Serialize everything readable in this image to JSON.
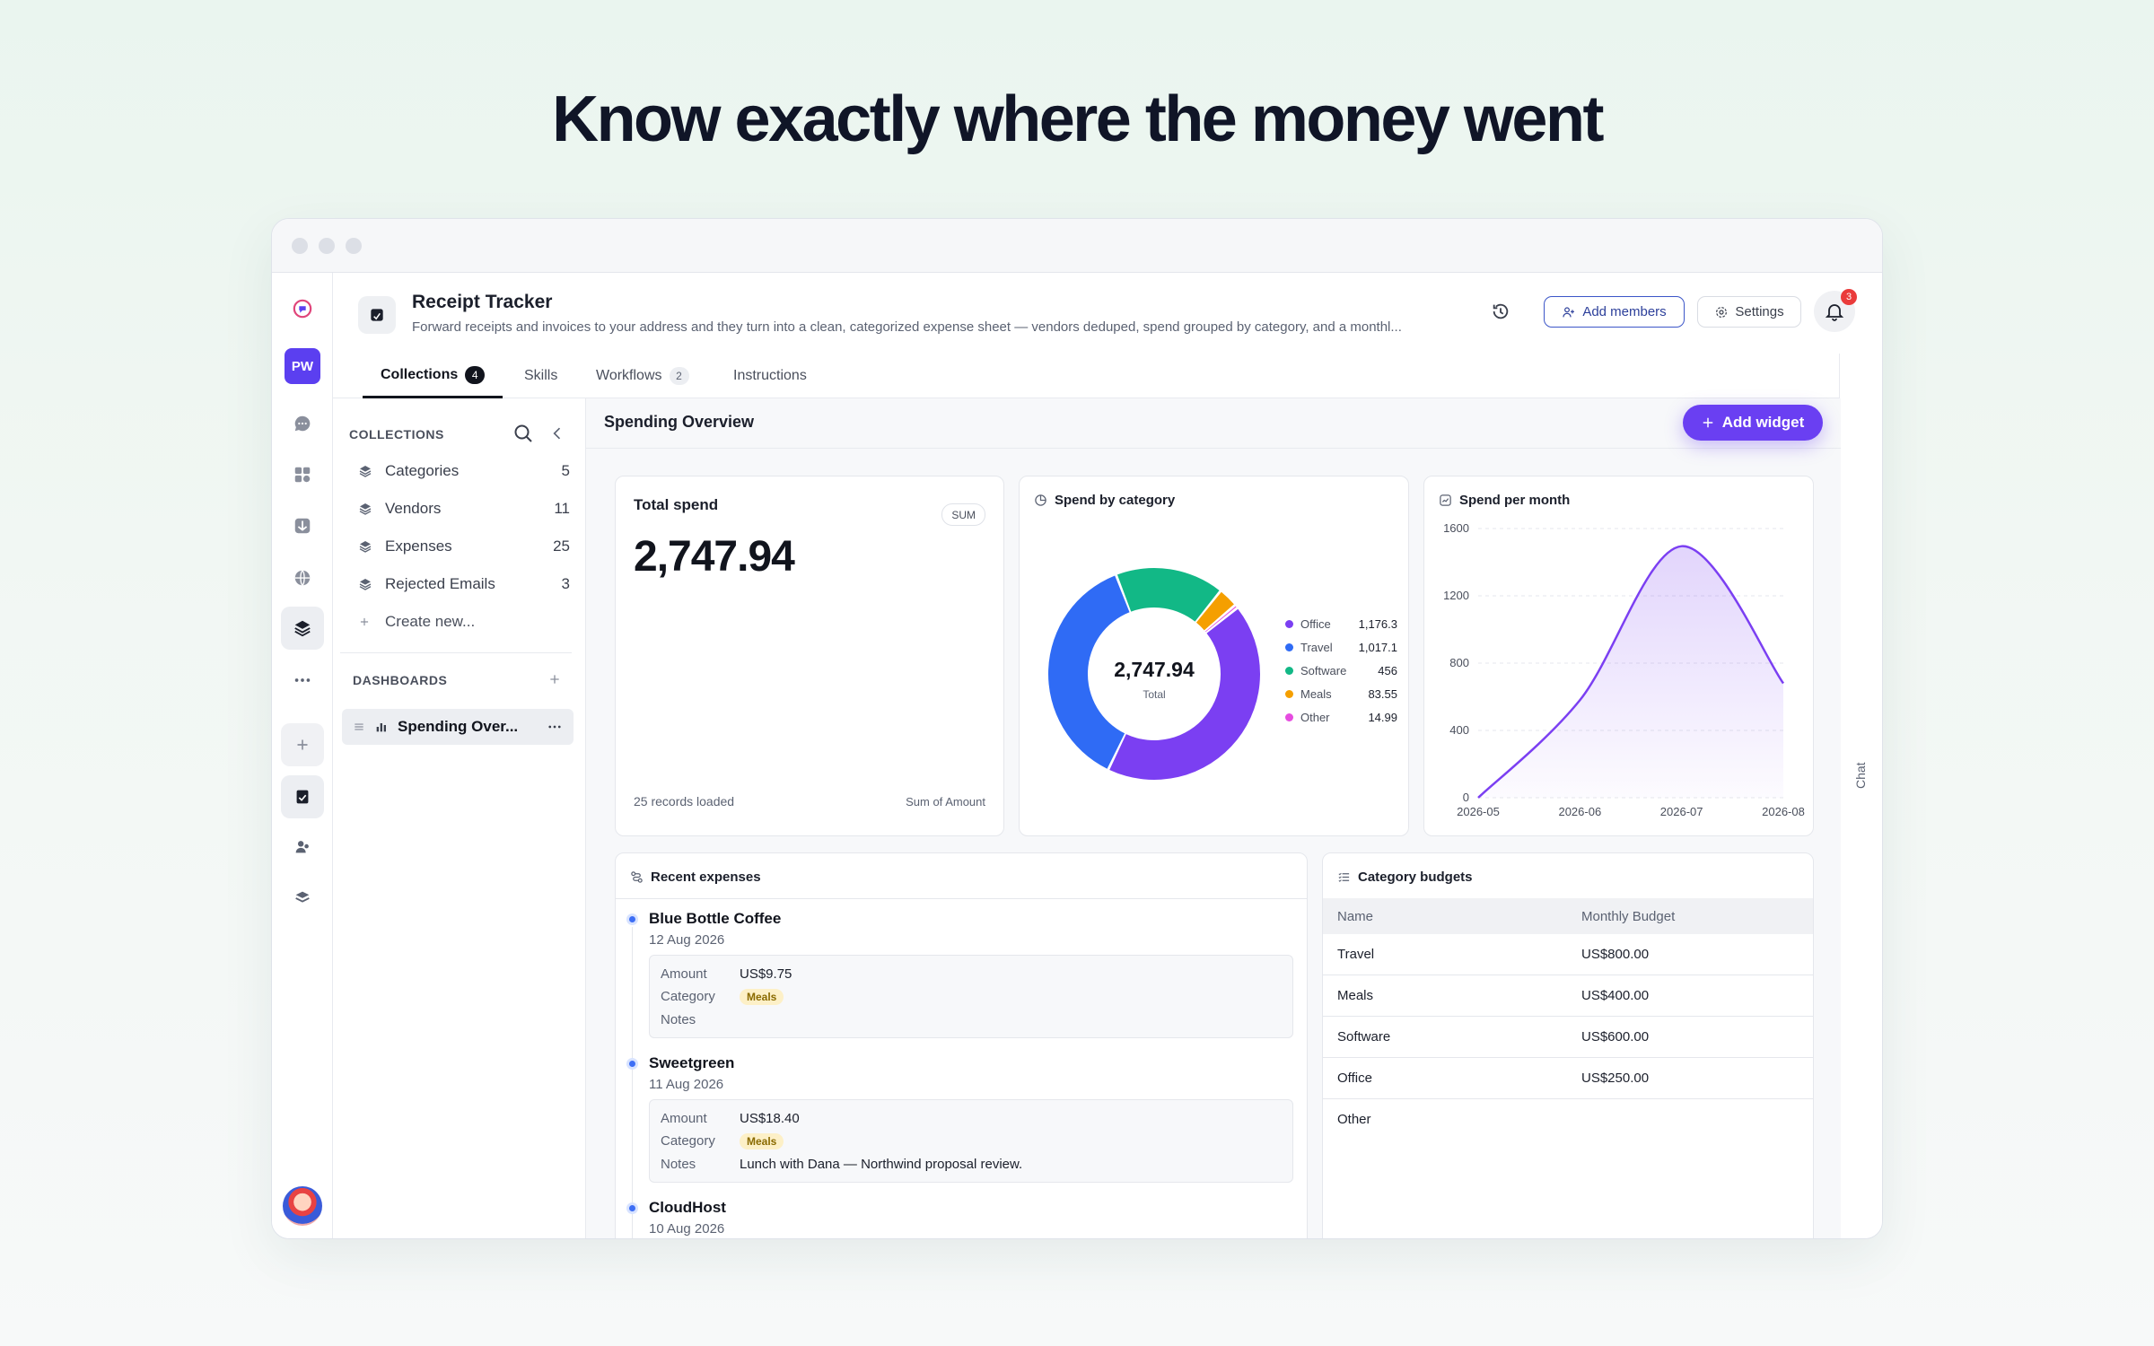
{
  "headline": "Know exactly where the money went",
  "app": {
    "title": "Receipt Tracker",
    "description": "Forward receipts and invoices to your address and they turn into a clean, categorized expense sheet — vendors deduped, spend grouped by category, and a monthl...",
    "workspace_initials": "PW",
    "add_members_label": "Add members",
    "settings_label": "Settings",
    "notification_count": "3"
  },
  "tabs": [
    {
      "label": "Collections",
      "count": "4"
    },
    {
      "label": "Skills",
      "count": ""
    },
    {
      "label": "Workflows",
      "count": "2"
    },
    {
      "label": "Instructions",
      "count": ""
    }
  ],
  "sidebar": {
    "collections_header": "COLLECTIONS",
    "collections": [
      {
        "name": "Categories",
        "count": "5"
      },
      {
        "name": "Vendors",
        "count": "11"
      },
      {
        "name": "Expenses",
        "count": "25"
      },
      {
        "name": "Rejected Emails",
        "count": "3"
      }
    ],
    "create_new_label": "Create new...",
    "dashboards_header": "DASHBOARDS",
    "dashboard_item": "Spending Over..."
  },
  "main": {
    "title": "Spending Overview",
    "add_widget_label": "Add widget"
  },
  "total_card": {
    "title": "Total spend",
    "badge": "SUM",
    "value": "2,747.94",
    "footer_left": "25 records loaded",
    "footer_right": "Sum of Amount"
  },
  "chat_label": "Chat",
  "colors": {
    "accent": "#6a3ff2",
    "office": "#7b3ff2",
    "travel": "#2f6bf5",
    "software": "#12b886",
    "meals": "#f59f00",
    "other": "#e64ce0"
  },
  "chart_data": [
    {
      "type": "pie",
      "title": "Spend by category",
      "center_value": "2,747.94",
      "center_label": "Total",
      "categories": [
        "Office",
        "Travel",
        "Software",
        "Meals",
        "Other"
      ],
      "values": [
        1176.3,
        1017.1,
        456,
        83.55,
        14.99
      ],
      "value_labels": [
        "1,176.3",
        "1,017.1",
        "456",
        "83.55",
        "14.99"
      ],
      "colors": [
        "#7b3ff2",
        "#2f6bf5",
        "#12b886",
        "#f59f00",
        "#e64ce0"
      ],
      "legend": "right"
    },
    {
      "type": "area",
      "title": "Spend per month",
      "x": [
        "2026-05",
        "2026-06",
        "2026-07",
        "2026-08"
      ],
      "y": [
        0,
        580,
        1495,
        680
      ],
      "ylim": [
        0,
        1600
      ],
      "yticks": [
        "0",
        "400",
        "800",
        "1200",
        "1600"
      ],
      "grid": true,
      "color": "#7b3ff2"
    }
  ],
  "recent": {
    "title": "Recent expenses",
    "items": [
      {
        "vendor": "Blue Bottle Coffee",
        "date": "12 Aug 2026",
        "amount_label": "Amount",
        "amount": "US$9.75",
        "category_label": "Category",
        "category": "Meals",
        "notes_label": "Notes",
        "notes": ""
      },
      {
        "vendor": "Sweetgreen",
        "date": "11 Aug 2026",
        "amount_label": "Amount",
        "amount": "US$18.40",
        "category_label": "Category",
        "category": "Meals",
        "notes_label": "Notes",
        "notes": "Lunch with Dana — Northwind proposal review."
      },
      {
        "vendor": "CloudHost",
        "date": "10 Aug 2026"
      }
    ]
  },
  "budgets": {
    "title": "Category budgets",
    "columns": [
      "Name",
      "Monthly Budget"
    ],
    "rows": [
      [
        "Travel",
        "US$800.00"
      ],
      [
        "Meals",
        "US$400.00"
      ],
      [
        "Software",
        "US$600.00"
      ],
      [
        "Office",
        "US$250.00"
      ],
      [
        "Other",
        ""
      ]
    ]
  }
}
